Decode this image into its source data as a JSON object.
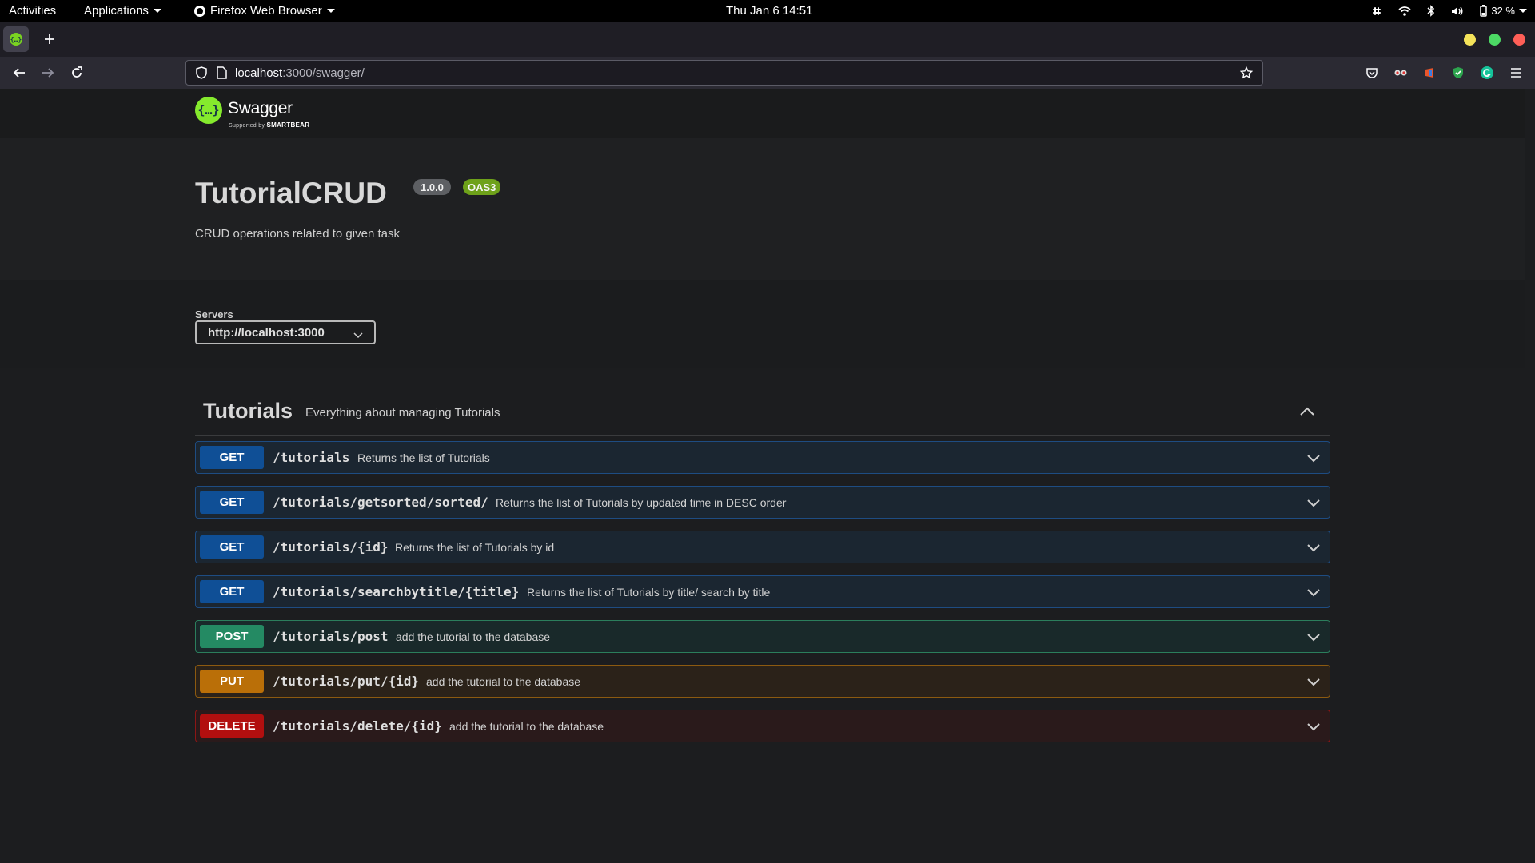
{
  "system_bar": {
    "activities": "Activities",
    "applications": "Applications",
    "browser_menu": "Firefox Web Browser",
    "clock": "Thu Jan 6  14:51",
    "battery": "32 %"
  },
  "browser": {
    "url_host": "localhost",
    "url_path": ":3000/swagger/"
  },
  "swagger": {
    "brand": "Swagger",
    "brand_sub": "Supported by",
    "brand_sub_company": "SMARTBEAR",
    "logo_glyph": "{…}"
  },
  "info": {
    "title": "TutorialCRUD",
    "version": "1.0.0",
    "oas": "OAS3",
    "description": "CRUD operations related to given task"
  },
  "servers": {
    "label": "Servers",
    "selected": "http://localhost:3000"
  },
  "tag": {
    "name": "Tutorials",
    "description": "Everything about managing Tutorials"
  },
  "operations": [
    {
      "method": "GET",
      "path": "/tutorials",
      "summary": "Returns the list of Tutorials"
    },
    {
      "method": "GET",
      "path": "/tutorials/getsorted/sorted/",
      "summary": "Returns the list of Tutorials by updated time in DESC order"
    },
    {
      "method": "GET",
      "path": "/tutorials/{id}",
      "summary": "Returns the list of Tutorials by id"
    },
    {
      "method": "GET",
      "path": "/tutorials/searchbytitle/{title}",
      "summary": "Returns the list of Tutorials by title/ search by title"
    },
    {
      "method": "POST",
      "path": "/tutorials/post",
      "summary": "add the tutorial to the database"
    },
    {
      "method": "PUT",
      "path": "/tutorials/put/{id}",
      "summary": "add the tutorial to the database"
    },
    {
      "method": "DELETE",
      "path": "/tutorials/delete/{id}",
      "summary": "add the tutorial to the database"
    }
  ],
  "colors": {
    "get": "#0f4f96",
    "post": "#248a63",
    "put": "#ba6f08",
    "delete": "#b20f0f",
    "swagger_green": "#85ea2d"
  }
}
